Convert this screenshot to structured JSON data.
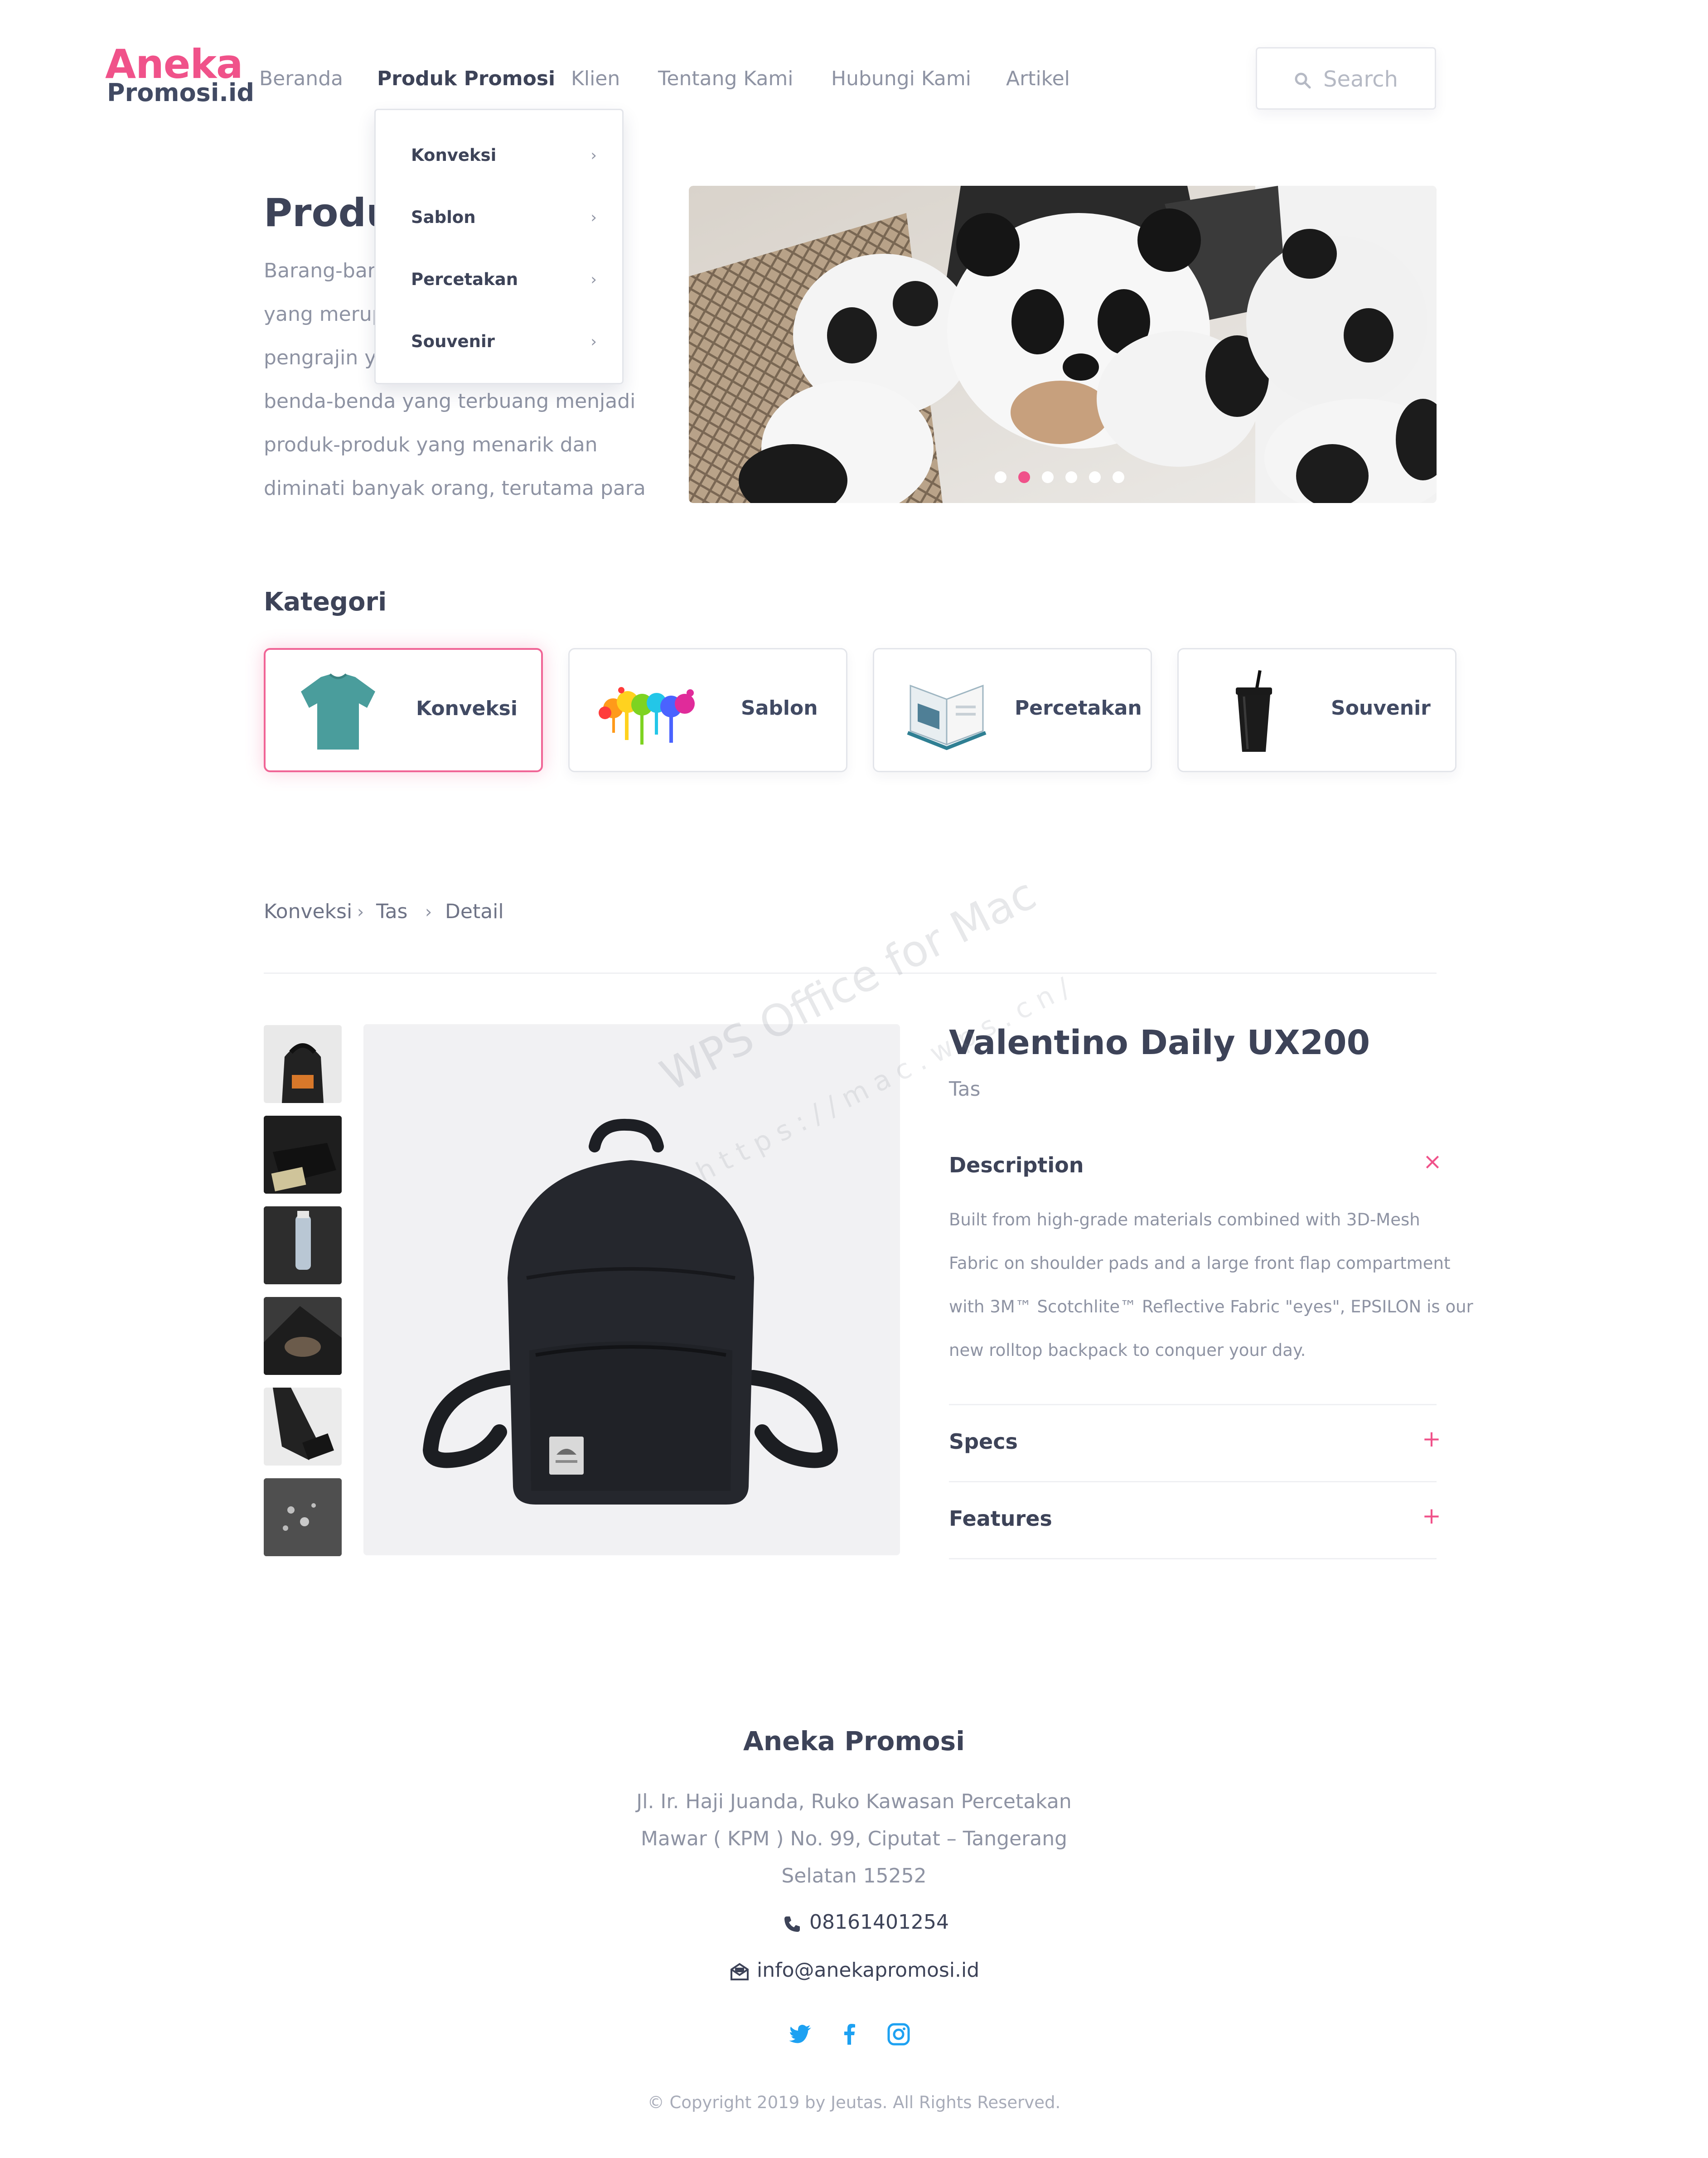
{
  "logo": {
    "top": "Aneka",
    "bottom": "Promosi.id"
  },
  "nav": {
    "items": [
      "Beranda",
      "Produk Promosi",
      "Klien",
      "Tentang Kami",
      "Hubungi Kami",
      "Artikel"
    ],
    "active_index": 1
  },
  "search": {
    "placeholder": "Search"
  },
  "dropdown": {
    "items": [
      "Konveksi",
      "Sablon",
      "Percetakan",
      "Souvenir"
    ]
  },
  "hero": {
    "title": "Produ",
    "lines": [
      "Barang-bar",
      "yang merup",
      "pengrajin yo",
      "benda-benda yang terbuang menjadi",
      "produk-produk yang menarik dan",
      "diminati banyak orang, terutama para"
    ],
    "slider": {
      "slides": 6,
      "active_index": 1
    }
  },
  "categories": {
    "title": "Kategori",
    "items": [
      "Konveksi",
      "Sablon",
      "Percetakan",
      "Souvenir"
    ],
    "active_index": 0
  },
  "breadcrumb": [
    "Konveksi",
    "Tas",
    "Detail"
  ],
  "product": {
    "name": "Valentino Daily UX200",
    "category": "Tas",
    "thumbnails": 6,
    "accordion": [
      {
        "title": "Description",
        "expanded": true,
        "toggle": "×",
        "lines": [
          "Built from high-grade materials combined with 3D-Mesh",
          "Fabric on shoulder pads and a large front flap compartment",
          "with 3M™ Scotchlite™ Reflective Fabric \"eyes\", EPSILON is our",
          "new rolltop backpack to conquer your day."
        ]
      },
      {
        "title": "Specs",
        "expanded": false,
        "toggle": "+"
      },
      {
        "title": "Features",
        "expanded": false,
        "toggle": "+"
      }
    ]
  },
  "footer": {
    "title": "Aneka Promosi",
    "address": [
      "Jl. Ir. Haji Juanda, Ruko Kawasan Percetakan",
      "Mawar ( KPM ) No. 99, Ciputat – Tangerang",
      "Selatan 15252"
    ],
    "phone": "08161401254",
    "email": "info@anekapromosi.id",
    "social": [
      "twitter-icon",
      "facebook-icon",
      "instagram-icon"
    ],
    "copyright": "© Copyright 2019 by Jeutas. All Rights Reserved."
  },
  "watermark": {
    "line1": "WPS Office for Mac",
    "line2": "https://mac.wps.cn/"
  },
  "colors": {
    "brand_pink": "#f0528a",
    "text_dark": "#3d4358",
    "text_muted": "#8e93a3",
    "social_blue": "#1da1f2"
  }
}
